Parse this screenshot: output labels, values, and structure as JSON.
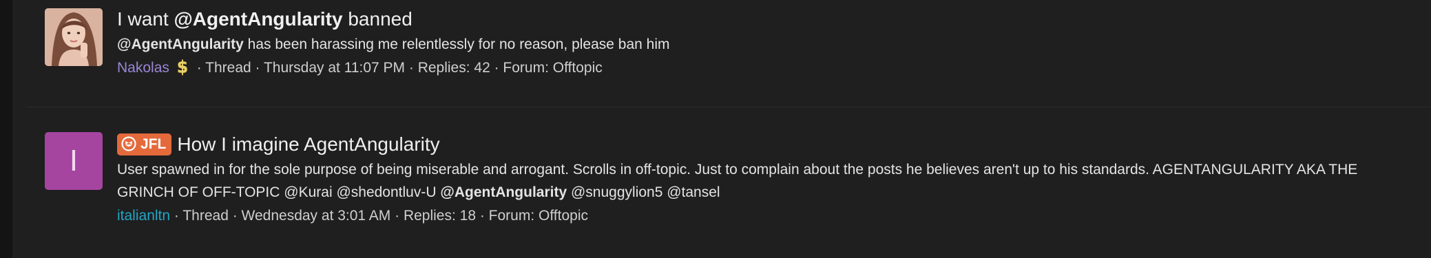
{
  "threads": [
    {
      "title_pre": "I want ",
      "title_mention": "@AgentAngularity",
      "title_post": " banned",
      "snippet_mention": "@AgentAngularity",
      "snippet_text": " has been harassing me relentlessly for no reason, please ban him",
      "author": "Nakolas",
      "author_badge_icon": "dollar-icon",
      "meta_rest": " · Thread · Thursday at 11:07 PM · Replies: 42 · Forum: Offtopic",
      "avatar_type": "photo"
    },
    {
      "prefix_label": "JFL",
      "prefix_icon": "laughing-face-icon",
      "title": "How I imagine AgentAngularity",
      "snippet_pre": "User spawned in for the sole purpose of being miserable and arrogant. Scrolls in off-topic. Just to complain about the posts he believes aren't up to his standards. AGENTANGULARITY AKA THE GRINCH OF OFF-TOPIC @Kurai @shedontluv-U ",
      "snippet_mention": "@AgentAngularity",
      "snippet_post": " @snuggylion5 @tansel",
      "author": "italianltn",
      "meta_rest": " · Thread · Wednesday at 3:01 AM · Replies: 18 · Forum: Offtopic",
      "avatar_letter": "I"
    }
  ],
  "colors": {
    "background": "#1f1f1f",
    "author1": "#9a87d6",
    "author2": "#21a6c7",
    "prefix": "#e46a3c",
    "avatar2": "#a545a0"
  }
}
